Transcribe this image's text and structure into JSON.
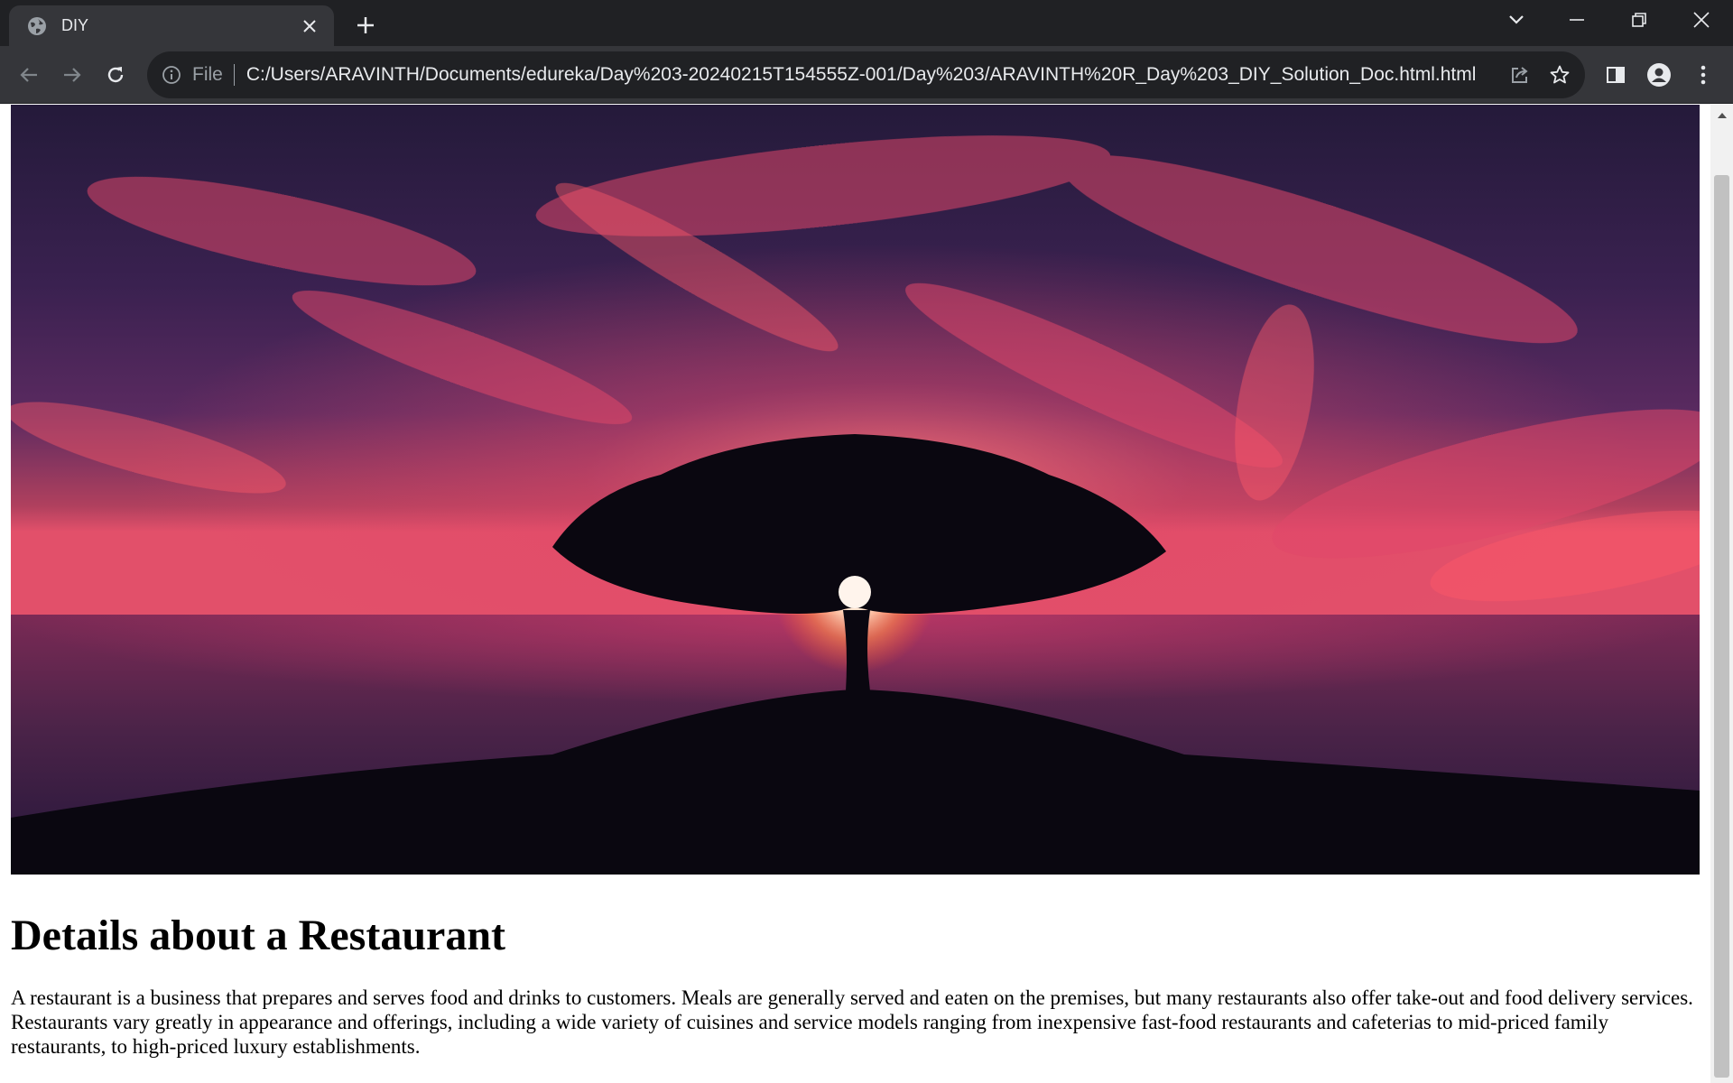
{
  "browser": {
    "tab": {
      "title": "DIY",
      "favicon": "globe-icon"
    },
    "omnibox": {
      "scheme_label": "File",
      "url": "C:/Users/ARAVINTH/Documents/edureka/Day%203-20240215T154555Z-001/Day%203/ARAVINTH%20R_Day%203_DIY_Solution_Doc.html.html"
    },
    "icons": {
      "back": "arrow-left-icon",
      "forward": "arrow-right-icon",
      "reload": "reload-icon",
      "share": "share-icon",
      "bookmark": "star-icon",
      "side_panel": "side-panel-icon",
      "profile": "profile-icon",
      "menu": "kebab-menu-icon",
      "tab_search": "chevron-down-icon",
      "minimize": "minimize-icon",
      "restore": "restore-icon",
      "close": "close-icon"
    },
    "colors": {
      "frame": "#202124",
      "toolbar": "#35363a",
      "text": "#e8eaed",
      "muted": "#9aa0a6"
    }
  },
  "page": {
    "hero_image": "sunset-tree-image",
    "heading": "Details about a Restaurant",
    "paragraph": "A restaurant is a business that prepares and serves food and drinks to customers. Meals are generally served and eaten on the premises, but many restaurants also offer take-out and food delivery services. Restaurants vary greatly in appearance and offerings, including a wide variety of cuisines and service models ranging from inexpensive fast-food restaurants and cafeterias to mid-priced family restaurants, to high-priced luxury establishments."
  }
}
